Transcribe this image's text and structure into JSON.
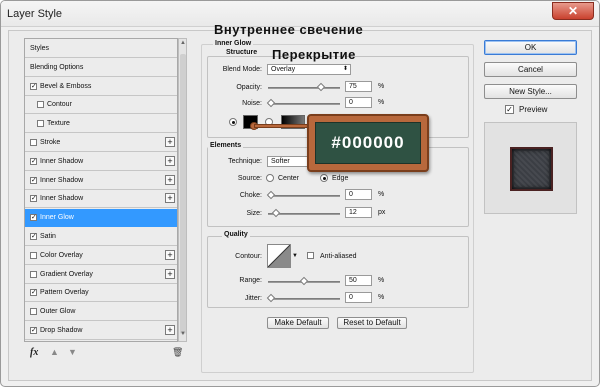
{
  "window": {
    "title": "Layer Style",
    "close_glyph": "✕"
  },
  "overlay_text": {
    "line1": "Внутреннее свечение",
    "line2": "Перекрытие"
  },
  "sidebar": {
    "items": [
      {
        "label": "Styles",
        "checkbox": false,
        "checked": false,
        "indent": false,
        "plus": false,
        "selected": false
      },
      {
        "label": "Blending Options",
        "checkbox": false,
        "checked": false,
        "indent": false,
        "plus": false,
        "selected": false
      },
      {
        "label": "Bevel & Emboss",
        "checkbox": true,
        "checked": true,
        "indent": false,
        "plus": false,
        "selected": false
      },
      {
        "label": "Contour",
        "checkbox": true,
        "checked": false,
        "indent": true,
        "plus": false,
        "selected": false
      },
      {
        "label": "Texture",
        "checkbox": true,
        "checked": false,
        "indent": true,
        "plus": false,
        "selected": false
      },
      {
        "label": "Stroke",
        "checkbox": true,
        "checked": false,
        "indent": false,
        "plus": true,
        "selected": false
      },
      {
        "label": "Inner Shadow",
        "checkbox": true,
        "checked": true,
        "indent": false,
        "plus": true,
        "selected": false
      },
      {
        "label": "Inner Shadow",
        "checkbox": true,
        "checked": true,
        "indent": false,
        "plus": true,
        "selected": false
      },
      {
        "label": "Inner Shadow",
        "checkbox": true,
        "checked": true,
        "indent": false,
        "plus": true,
        "selected": false
      },
      {
        "label": "Inner Glow",
        "checkbox": true,
        "checked": true,
        "indent": false,
        "plus": false,
        "selected": true
      },
      {
        "label": "Satin",
        "checkbox": true,
        "checked": true,
        "indent": false,
        "plus": false,
        "selected": false
      },
      {
        "label": "Color Overlay",
        "checkbox": true,
        "checked": false,
        "indent": false,
        "plus": true,
        "selected": false
      },
      {
        "label": "Gradient Overlay",
        "checkbox": true,
        "checked": false,
        "indent": false,
        "plus": true,
        "selected": false
      },
      {
        "label": "Pattern Overlay",
        "checkbox": true,
        "checked": true,
        "indent": false,
        "plus": false,
        "selected": false
      },
      {
        "label": "Outer Glow",
        "checkbox": true,
        "checked": false,
        "indent": false,
        "plus": false,
        "selected": false
      },
      {
        "label": "Drop Shadow",
        "checkbox": true,
        "checked": true,
        "indent": false,
        "plus": true,
        "selected": false
      },
      {
        "label": "Drop Shadow",
        "checkbox": true,
        "checked": true,
        "indent": false,
        "plus": true,
        "selected": false
      }
    ],
    "fx_label": "fx"
  },
  "inner_glow": {
    "title": "Inner Glow",
    "structure": {
      "title": "Structure",
      "blend_mode_label": "Blend Mode:",
      "blend_mode_value": "Overlay",
      "opacity_label": "Opacity:",
      "opacity_value": "75",
      "opacity_level": 0.75,
      "noise_label": "Noise:",
      "noise_value": "0",
      "noise_level": 0,
      "percent": "%",
      "color_swatch": "#000000"
    },
    "elements": {
      "title": "Elements",
      "technique_label": "Technique:",
      "technique_value": "Softer",
      "source_label": "Source:",
      "source_center": "Center",
      "source_edge": "Edge",
      "choke_label": "Choke:",
      "choke_value": "0",
      "choke_level": 0,
      "size_label": "Size:",
      "size_value": "12",
      "size_level": 0.08,
      "px": "px",
      "percent": "%"
    },
    "quality": {
      "title": "Quality",
      "contour_label": "Contour:",
      "anti_aliased_label": "Anti-aliased",
      "range_label": "Range:",
      "range_value": "50",
      "range_level": 0.5,
      "jitter_label": "Jitter:",
      "jitter_value": "0",
      "jitter_level": 0,
      "percent": "%"
    },
    "make_default_label": "Make Default",
    "reset_default_label": "Reset to Default"
  },
  "buttons": {
    "ok": "OK",
    "cancel": "Cancel",
    "new_style": "New Style...",
    "preview_label": "Preview"
  },
  "board": {
    "text": "#000000"
  }
}
